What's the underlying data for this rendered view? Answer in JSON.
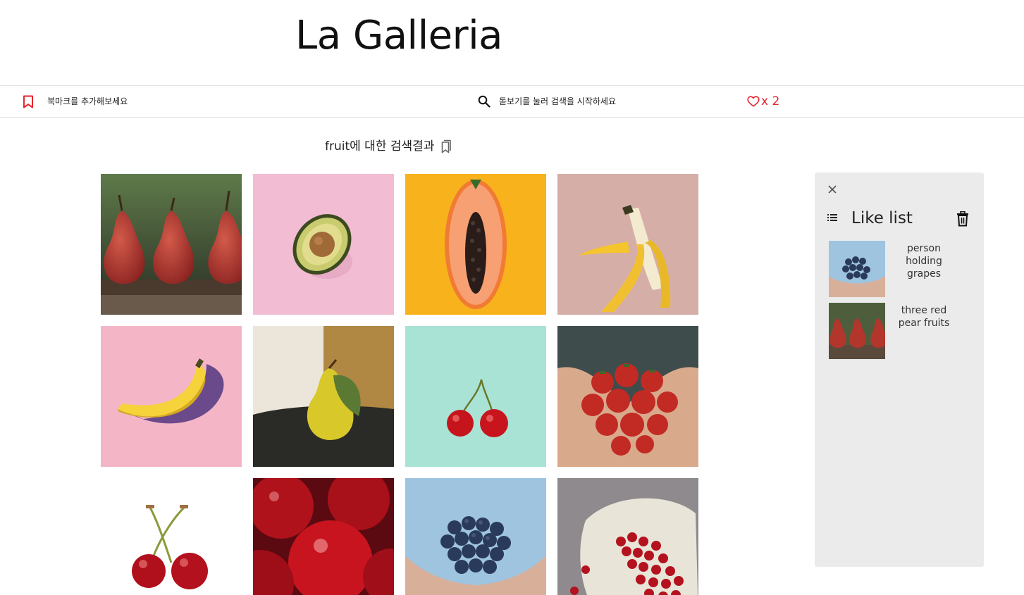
{
  "header": {
    "logo": "La Galleria"
  },
  "topbar": {
    "bookmark_hint": "북마크를 추가해보세요",
    "search_placeholder": "돋보기를 눌러 검색을 시작하세요",
    "like_count_label": "x 2",
    "accent_color": "#e8232f"
  },
  "results": {
    "query": "fruit",
    "suffix": "에 대한 검색결과",
    "images": [
      {
        "subject": "three red pear fruits"
      },
      {
        "subject": "avocado half on pink"
      },
      {
        "subject": "papaya half on yellow"
      },
      {
        "subject": "peeled banana on pink"
      },
      {
        "subject": "banana on pink"
      },
      {
        "subject": "pear with leaf"
      },
      {
        "subject": "cherries on mint"
      },
      {
        "subject": "hands holding strawberries"
      },
      {
        "subject": "two cherries on white"
      },
      {
        "subject": "close-up red cherries"
      },
      {
        "subject": "person holding grapes"
      },
      {
        "subject": "cherries in cloth bag"
      }
    ]
  },
  "like_panel": {
    "title": "Like list",
    "items": [
      {
        "label": "person holding grapes",
        "thumb": "grapes"
      },
      {
        "label": "three red pear fruits",
        "thumb": "pears"
      }
    ]
  }
}
